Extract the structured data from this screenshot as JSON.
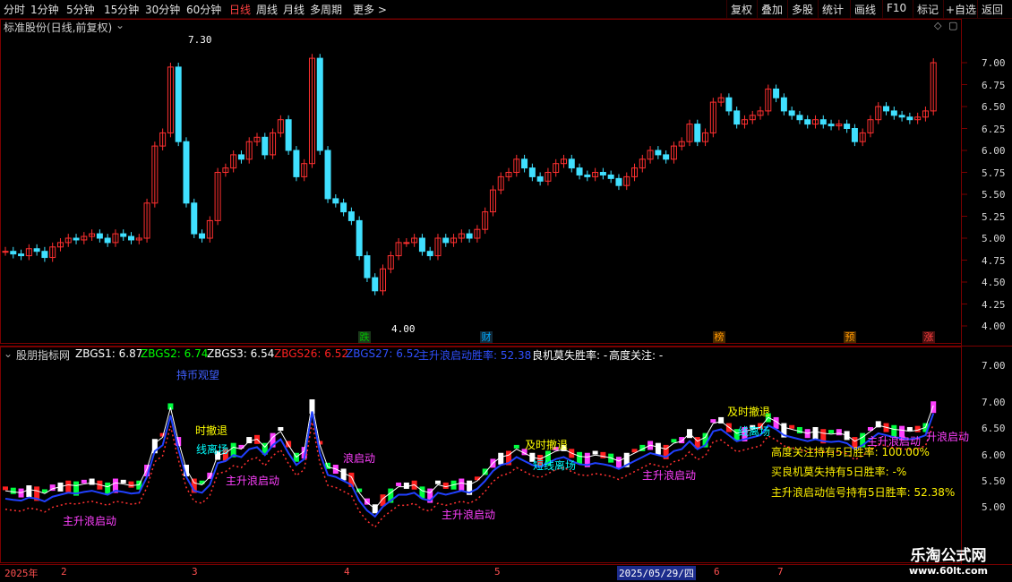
{
  "toolbar": {
    "periods": [
      "分时",
      "1分钟",
      "5分钟",
      "15分钟",
      "30分钟",
      "60分钟",
      "日线",
      "周线",
      "月线",
      "多周期",
      "更多 >"
    ],
    "active_period": "日线",
    "right_buttons": [
      "复权",
      "叠加",
      "多股",
      "统计",
      "画线",
      "F10",
      "标记",
      "+自选",
      "返回"
    ]
  },
  "main_panel": {
    "title": "标准股份(日线,前复权)",
    "high_label": "7.30",
    "low_label": "4.00",
    "y_ticks": [
      "7.00",
      "6.75",
      "6.50",
      "6.25",
      "6.00",
      "5.75",
      "5.50",
      "5.25",
      "5.00",
      "4.75",
      "4.50",
      "4.25",
      "4.00"
    ],
    "event_markers": [
      {
        "text": "跌",
        "color": "#00c000"
      },
      {
        "text": "财",
        "color": "#00aaff"
      },
      {
        "text": "榜",
        "color": "#ff9900"
      },
      {
        "text": "预",
        "color": "#ff9900"
      },
      {
        "text": "涨",
        "color": "#ff4040"
      }
    ]
  },
  "indicator_panel": {
    "name": "股朋指标网",
    "fields": [
      {
        "text": "ZBGS1: 6.87",
        "color": "#ffffff"
      },
      {
        "text": "ZBGS2: 6.74",
        "color": "#00ff00"
      },
      {
        "text": "ZBGS3: 6.54",
        "color": "#ffffff"
      },
      {
        "text": "ZBGS26: 6.52",
        "color": "#ff2020"
      },
      {
        "text": "ZBGS27: 6.52",
        "color": "#3050ff"
      },
      {
        "text": "主升浪启动胜率: 52.38",
        "color": "#3050ff"
      },
      {
        "text": "良机莫失胜率: -",
        "color": "#ffffff"
      },
      {
        "text": "高度关注: -",
        "color": "#ffffff"
      }
    ],
    "y_ticks": [
      "7.00",
      "6.50",
      "6.00",
      "5.50",
      "5.00"
    ],
    "annotations": [
      {
        "text": "持币观望",
        "color": "#4060ff"
      },
      {
        "text": "时撤退",
        "color": "#ffff00"
      },
      {
        "text": "线离场",
        "color": "#00ffff"
      },
      {
        "text": "主升浪启动",
        "color": "#ff40ff"
      },
      {
        "text": "浪启动",
        "color": "#ff40ff"
      },
      {
        "text": "主升浪启动",
        "color": "#ff40ff"
      },
      {
        "text": "主升浪启动",
        "color": "#ff40ff"
      },
      {
        "text": "及时撤退",
        "color": "#ffff00"
      },
      {
        "text": "短线离场",
        "color": "#00ffff"
      },
      {
        "text": "主升浪启动",
        "color": "#ff40ff"
      },
      {
        "text": "及时撤退",
        "color": "#ffff00"
      },
      {
        "text": "线离场",
        "color": "#00ffff"
      },
      {
        "text": "主升浪启动",
        "color": "#ff40ff"
      },
      {
        "text": "升浪启动",
        "color": "#ff40ff"
      }
    ],
    "stats": [
      "高度关注持有5日胜率: 100.00%",
      "买良机莫失持有5日胜率: -%",
      "主升浪启动信号持有5日胜率: 52.38%"
    ]
  },
  "time_axis": {
    "labels": [
      "2025年",
      "2",
      "3",
      "4",
      "5",
      "2025/05/29/四",
      "6",
      "7"
    ]
  },
  "watermark": {
    "line1": "乐淘公式网",
    "line2": "www.60lt.com"
  }
}
